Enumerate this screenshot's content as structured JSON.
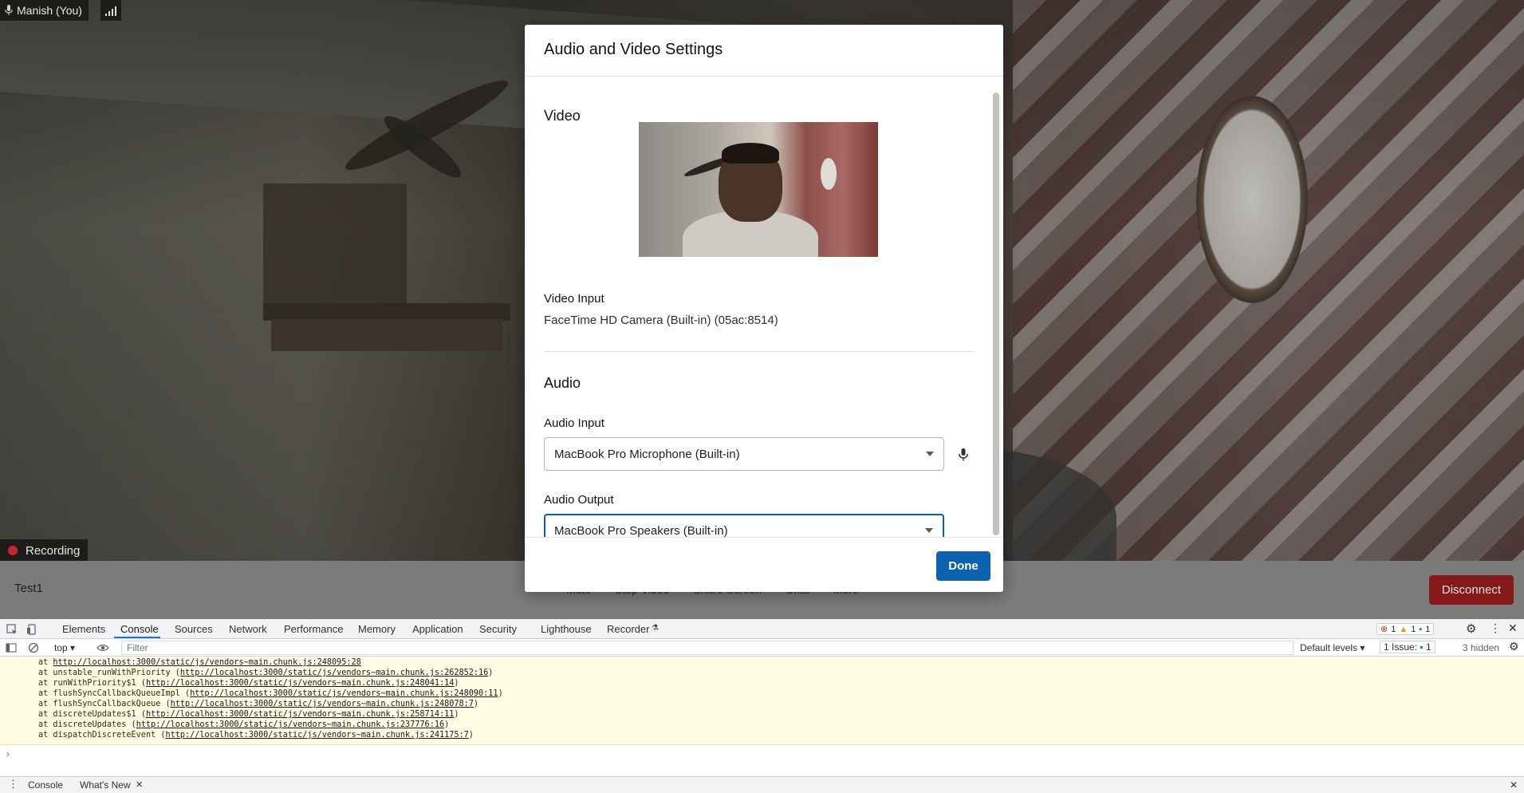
{
  "video": {
    "participant_name": "Manish (You)",
    "recording_label": "Recording"
  },
  "callbar": {
    "room_name": "Test1",
    "controls": [
      "Mute",
      "Stop Video",
      "Share Screen",
      "Chat",
      "More"
    ],
    "disconnect_label": "Disconnect"
  },
  "modal": {
    "title": "Audio and Video Settings",
    "video_section_title": "Video",
    "video_input_label": "Video Input",
    "video_input_value": "FaceTime HD Camera (Built-in) (05ac:8514)",
    "audio_section_title": "Audio",
    "audio_input_label": "Audio Input",
    "audio_input_value": "MacBook Pro Microphone (Built-in)",
    "audio_output_label": "Audio Output",
    "audio_output_value": "MacBook Pro Speakers (Built-in)",
    "done_label": "Done"
  },
  "devtools": {
    "tabs": [
      "Elements",
      "Console",
      "Sources",
      "Network",
      "Performance",
      "Memory",
      "Application",
      "Security",
      "Lighthouse",
      "Recorder"
    ],
    "active_tab": "Console",
    "context": "top",
    "filter_placeholder": "Filter",
    "levels": "Default levels",
    "issues": "1 Issue:",
    "issues_count": "1",
    "hidden": "3 hidden",
    "error_count": "1",
    "warning_count": "1",
    "message_count": "1",
    "trace": [
      {
        "prefix": "at ",
        "fn": "",
        "url": "http://localhost:3000/static/js/vendors~main.chunk.js:248095:28"
      },
      {
        "prefix": "at ",
        "fn": "unstable_runWithPriority ",
        "url": "http://localhost:3000/static/js/vendors~main.chunk.js:262852:16"
      },
      {
        "prefix": "at ",
        "fn": "runWithPriority$1 ",
        "url": "http://localhost:3000/static/js/vendors~main.chunk.js:248041:14"
      },
      {
        "prefix": "at ",
        "fn": "flushSyncCallbackQueueImpl ",
        "url": "http://localhost:3000/static/js/vendors~main.chunk.js:248090:11"
      },
      {
        "prefix": "at ",
        "fn": "flushSyncCallbackQueue ",
        "url": "http://localhost:3000/static/js/vendors~main.chunk.js:248078:7"
      },
      {
        "prefix": "at ",
        "fn": "discreteUpdates$1 ",
        "url": "http://localhost:3000/static/js/vendors~main.chunk.js:258714:11"
      },
      {
        "prefix": "at ",
        "fn": "discreteUpdates ",
        "url": "http://localhost:3000/static/js/vendors~main.chunk.js:237776:16"
      },
      {
        "prefix": "at ",
        "fn": "dispatchDiscreteEvent ",
        "url": "http://localhost:3000/static/js/vendors~main.chunk.js:241175:7"
      }
    ],
    "drawer_tabs": [
      "Console",
      "What's New"
    ]
  },
  "colors": {
    "primary": "#0b62b0",
    "disconnect": "#861a1a",
    "devtools_accent": "#1a73e8",
    "console_warning_bg": "#fffbe5"
  }
}
